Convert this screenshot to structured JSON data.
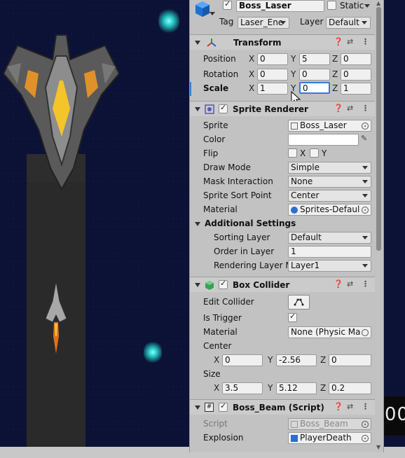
{
  "header": {
    "object_name": "Boss_Laser",
    "static_label": "Static",
    "tag_label": "Tag",
    "tag_value": "Laser_Ene",
    "layer_label": "Layer",
    "layer_value": "Default"
  },
  "transform": {
    "title": "Transform",
    "position_label": "Position",
    "rotation_label": "Rotation",
    "scale_label": "Scale",
    "position": {
      "x": "0",
      "y": "5",
      "z": "0"
    },
    "rotation": {
      "x": "0",
      "y": "0",
      "z": "0"
    },
    "scale": {
      "x": "1",
      "y": "0",
      "z": "1"
    },
    "axis": {
      "x": "X",
      "y": "Y",
      "z": "Z"
    }
  },
  "sprite_renderer": {
    "title": "Sprite Renderer",
    "sprite_label": "Sprite",
    "sprite_value": "Boss_Laser",
    "color_label": "Color",
    "flip_label": "Flip",
    "flip_x": "X",
    "flip_y": "Y",
    "draw_mode_label": "Draw Mode",
    "draw_mode_value": "Simple",
    "mask_label": "Mask Interaction",
    "mask_value": "None",
    "sort_point_label": "Sprite Sort Point",
    "sort_point_value": "Center",
    "material_label": "Material",
    "material_value": "Sprites-Defaul",
    "additional_title": "Additional Settings",
    "sorting_layer_label": "Sorting Layer",
    "sorting_layer_value": "Default",
    "order_label": "Order in Layer",
    "order_value": "1",
    "rendering_layer_label": "Rendering Layer M",
    "rendering_layer_value": "Layer1"
  },
  "box_collider": {
    "title": "Box Collider",
    "edit_label": "Edit Collider",
    "trigger_label": "Is Trigger",
    "material_label": "Material",
    "material_value": "None (Physic Ma",
    "center_label": "Center",
    "center": {
      "x": "0",
      "y": "-2.56",
      "z": "0"
    },
    "size_label": "Size",
    "size": {
      "x": "3.5",
      "y": "5.12",
      "z": "0.2"
    }
  },
  "script": {
    "title": "Boss_Beam (Script)",
    "script_label": "Script",
    "script_value": "Boss_Beam",
    "explosion_label": "Explosion",
    "explosion_value": "PlayerDeath"
  },
  "scene": {
    "score_text": "00"
  },
  "colors": {
    "scene_bg": "#0b1033",
    "inspector_bg": "#c2c2c2",
    "selected_field": "#3a78d8"
  }
}
